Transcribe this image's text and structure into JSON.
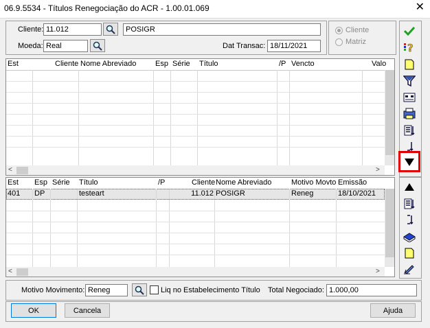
{
  "window": {
    "title": "06.9.5534 - Títulos Renegociação do ACR - 1.00.01.069"
  },
  "header": {
    "cliente_label": "Cliente:",
    "cliente_value": "11.012",
    "cliente_nome": "POSIGR",
    "moeda_label": "Moeda:",
    "moeda_value": "Real",
    "dat_transac_label": "Dat Transac:",
    "dat_transac_value": "18/11/2021",
    "radio_cliente": "Cliente",
    "radio_matriz": "Matriz"
  },
  "top_grid": {
    "columns": [
      "Est",
      "Cliente",
      "Nome Abreviado",
      "Esp",
      "Série",
      "Título",
      "/P",
      "Vencto",
      "Valo"
    ]
  },
  "bottom_grid": {
    "columns": [
      "Est",
      "Esp",
      "Série",
      "Título",
      "/P",
      "Cliente",
      "Nome Abreviado",
      "Motivo Movto",
      "Emissão"
    ],
    "rows": [
      {
        "est": "401",
        "esp": "DP",
        "serie": "",
        "titulo": "testeart",
        "p": "",
        "cliente": "11.012",
        "nome": "POSIGR",
        "motivo": "Reneg",
        "emissao": "18/10/2021"
      }
    ]
  },
  "footer": {
    "motivo_label": "Motivo Movimento:",
    "motivo_value": "Reneg",
    "liq_label": "Liq no Estabelecimento Título",
    "total_label": "Total Negociado:",
    "total_value": "1.000,00"
  },
  "buttons": {
    "ok": "OK",
    "cancel": "Cancela",
    "help": "Ajuda"
  },
  "colors": {
    "highlight": "#e00000",
    "check": "#22a022"
  }
}
